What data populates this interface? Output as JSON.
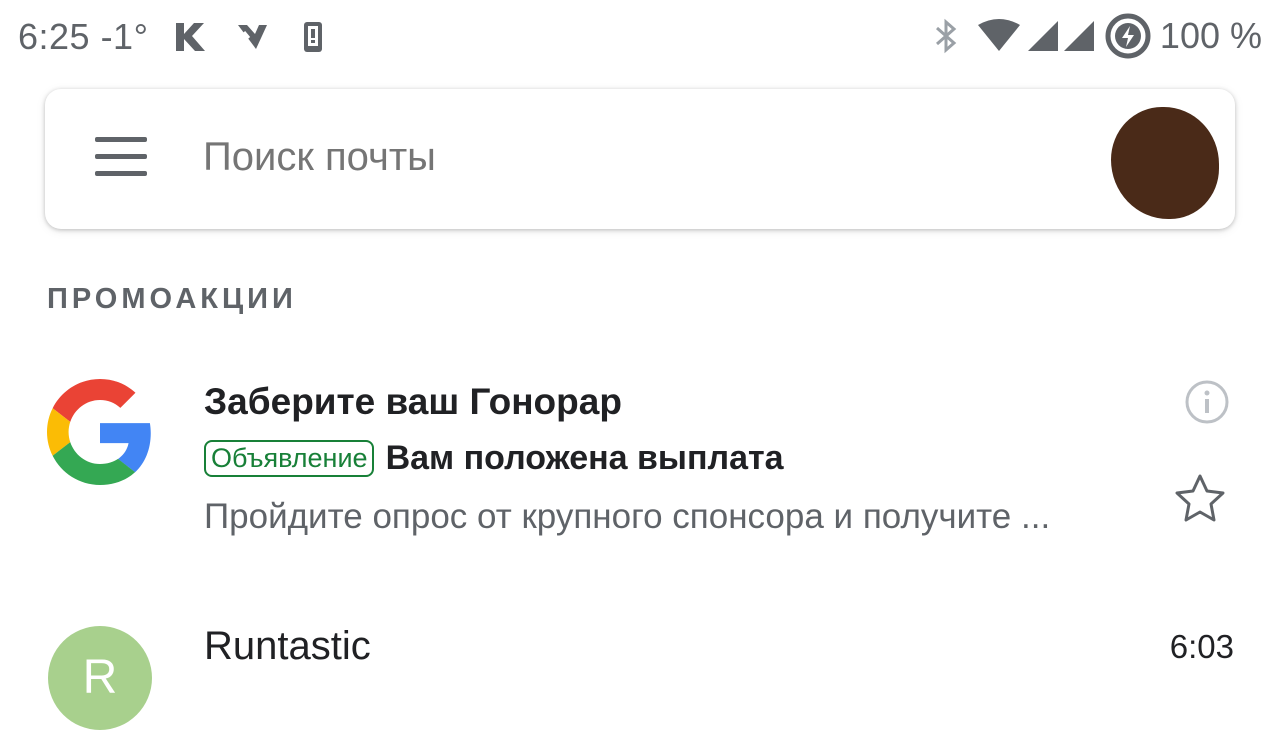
{
  "status_bar": {
    "time": "6:25 -1°",
    "battery": "100 %",
    "left_icons": [
      "k-app-icon",
      "check-app-icon",
      "phone-icon"
    ],
    "right_icons": [
      "bluetooth-icon",
      "wifi-icon",
      "signal-icon",
      "signal-icon",
      "battery-saver-icon"
    ]
  },
  "search": {
    "placeholder": "Поиск почты"
  },
  "section": {
    "label": "ПРОМОАКЦИИ"
  },
  "emails": [
    {
      "subject": "Заберите ваш Гонорар",
      "badge": "Объявление",
      "headline": "Вам положена выплата",
      "snippet": "Пройдите опрос от крупного спонсора и получите ...",
      "sender_icon": "google-logo-icon"
    },
    {
      "sender": "Runtastic",
      "time": "6:03",
      "avatar_letter": "R",
      "avatar_color": "#a8d08d"
    }
  ],
  "colors": {
    "ad_badge": "#188038",
    "secondary_text": "#5f6368",
    "avatar_user": "#4a2a18"
  }
}
